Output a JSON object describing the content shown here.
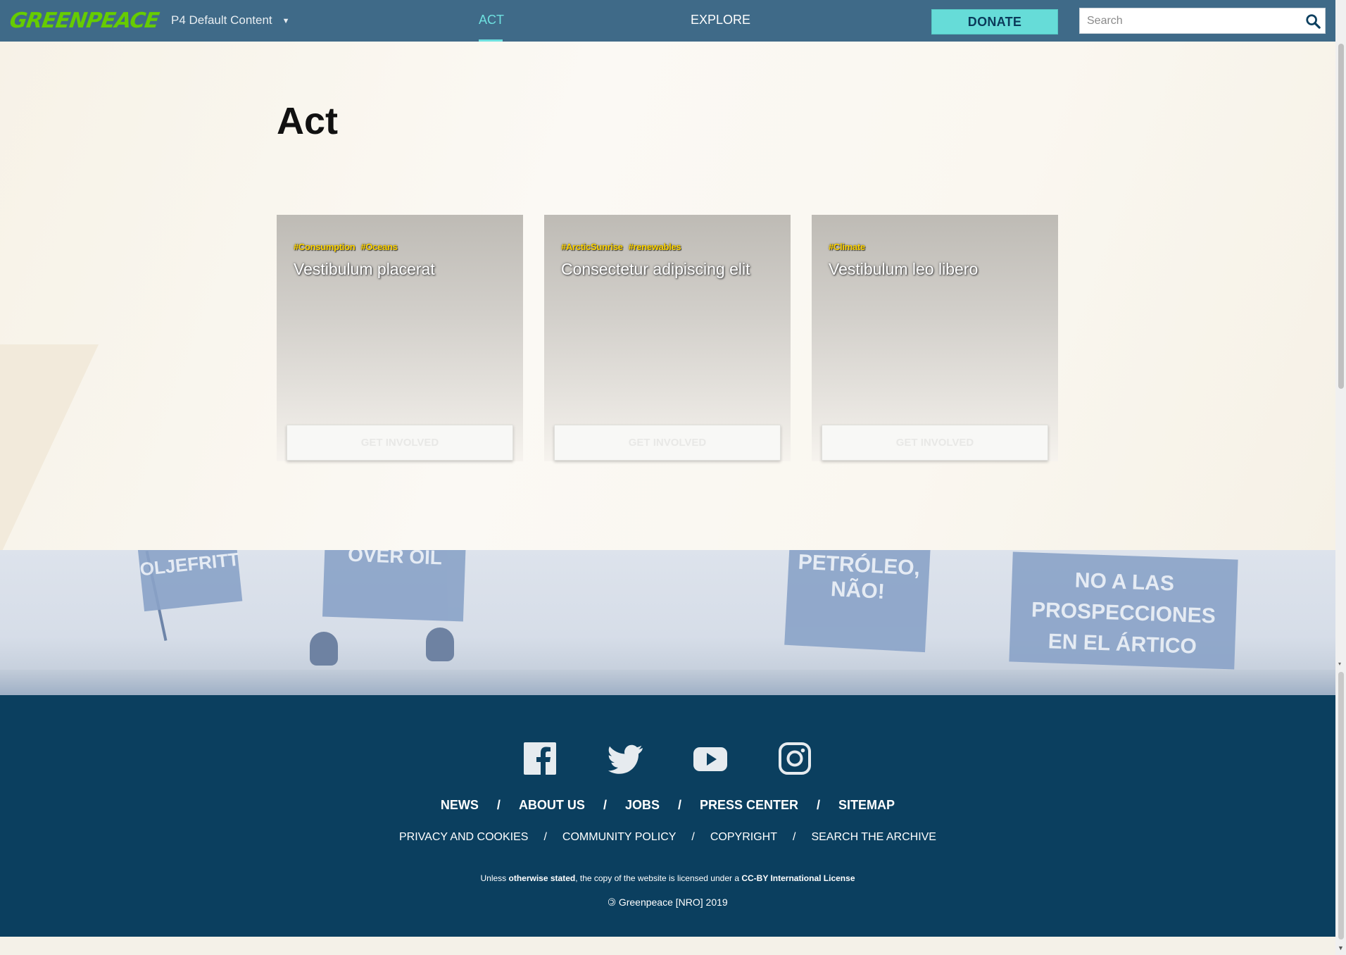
{
  "header": {
    "logo_text": "GREENPEACE",
    "site_selector": "P4 Default Content",
    "nav": [
      {
        "label": "ACT",
        "active": true
      },
      {
        "label": "EXPLORE",
        "active": false
      }
    ],
    "donate_label": "DONATE",
    "search_placeholder": "Search"
  },
  "page": {
    "title": "Act"
  },
  "cards": [
    {
      "tags": [
        "#Consumption",
        "#Oceans"
      ],
      "title": "Vestibulum placerat",
      "cta": "GET INVOLVED"
    },
    {
      "tags": [
        "#ArcticSunrise",
        "#renewables"
      ],
      "title": "Consectetur adipiscing elit",
      "cta": "GET INVOLVED"
    },
    {
      "tags": [
        "#Climate"
      ],
      "title": "Vestibulum leo libero",
      "cta": "GET INVOLVED"
    }
  ],
  "photo_banners": [
    "OLJEFRITT",
    "OVER OIL",
    "PETRÓLEO, NÃO!",
    "NO A LAS PROSPECCIONES EN EL ÁRTICO"
  ],
  "footer": {
    "social": [
      "facebook-icon",
      "twitter-icon",
      "youtube-icon",
      "instagram-icon"
    ],
    "main_links": [
      "NEWS",
      "ABOUT US",
      "JOBS",
      "PRESS CENTER",
      "SITEMAP"
    ],
    "sub_links": [
      "PRIVACY AND COOKIES",
      "COMMUNITY POLICY",
      "COPYRIGHT",
      "SEARCH THE ARCHIVE"
    ],
    "license_pre": "Unless ",
    "license_bold1": "otherwise stated",
    "license_mid": ", the copy of the website is licensed under a ",
    "license_bold2": "CC-BY International License",
    "copyright": "Greenpeace [NRO] 2019",
    "copyright_symbol": "🄯"
  },
  "colors": {
    "header_bg": "#3f6a88",
    "accent": "#6ee1e0",
    "donate_bg": "#66dcd8",
    "logo_green": "#66cc00",
    "tag_yellow": "#ffd400",
    "footer_bg": "#0b3f5f"
  }
}
